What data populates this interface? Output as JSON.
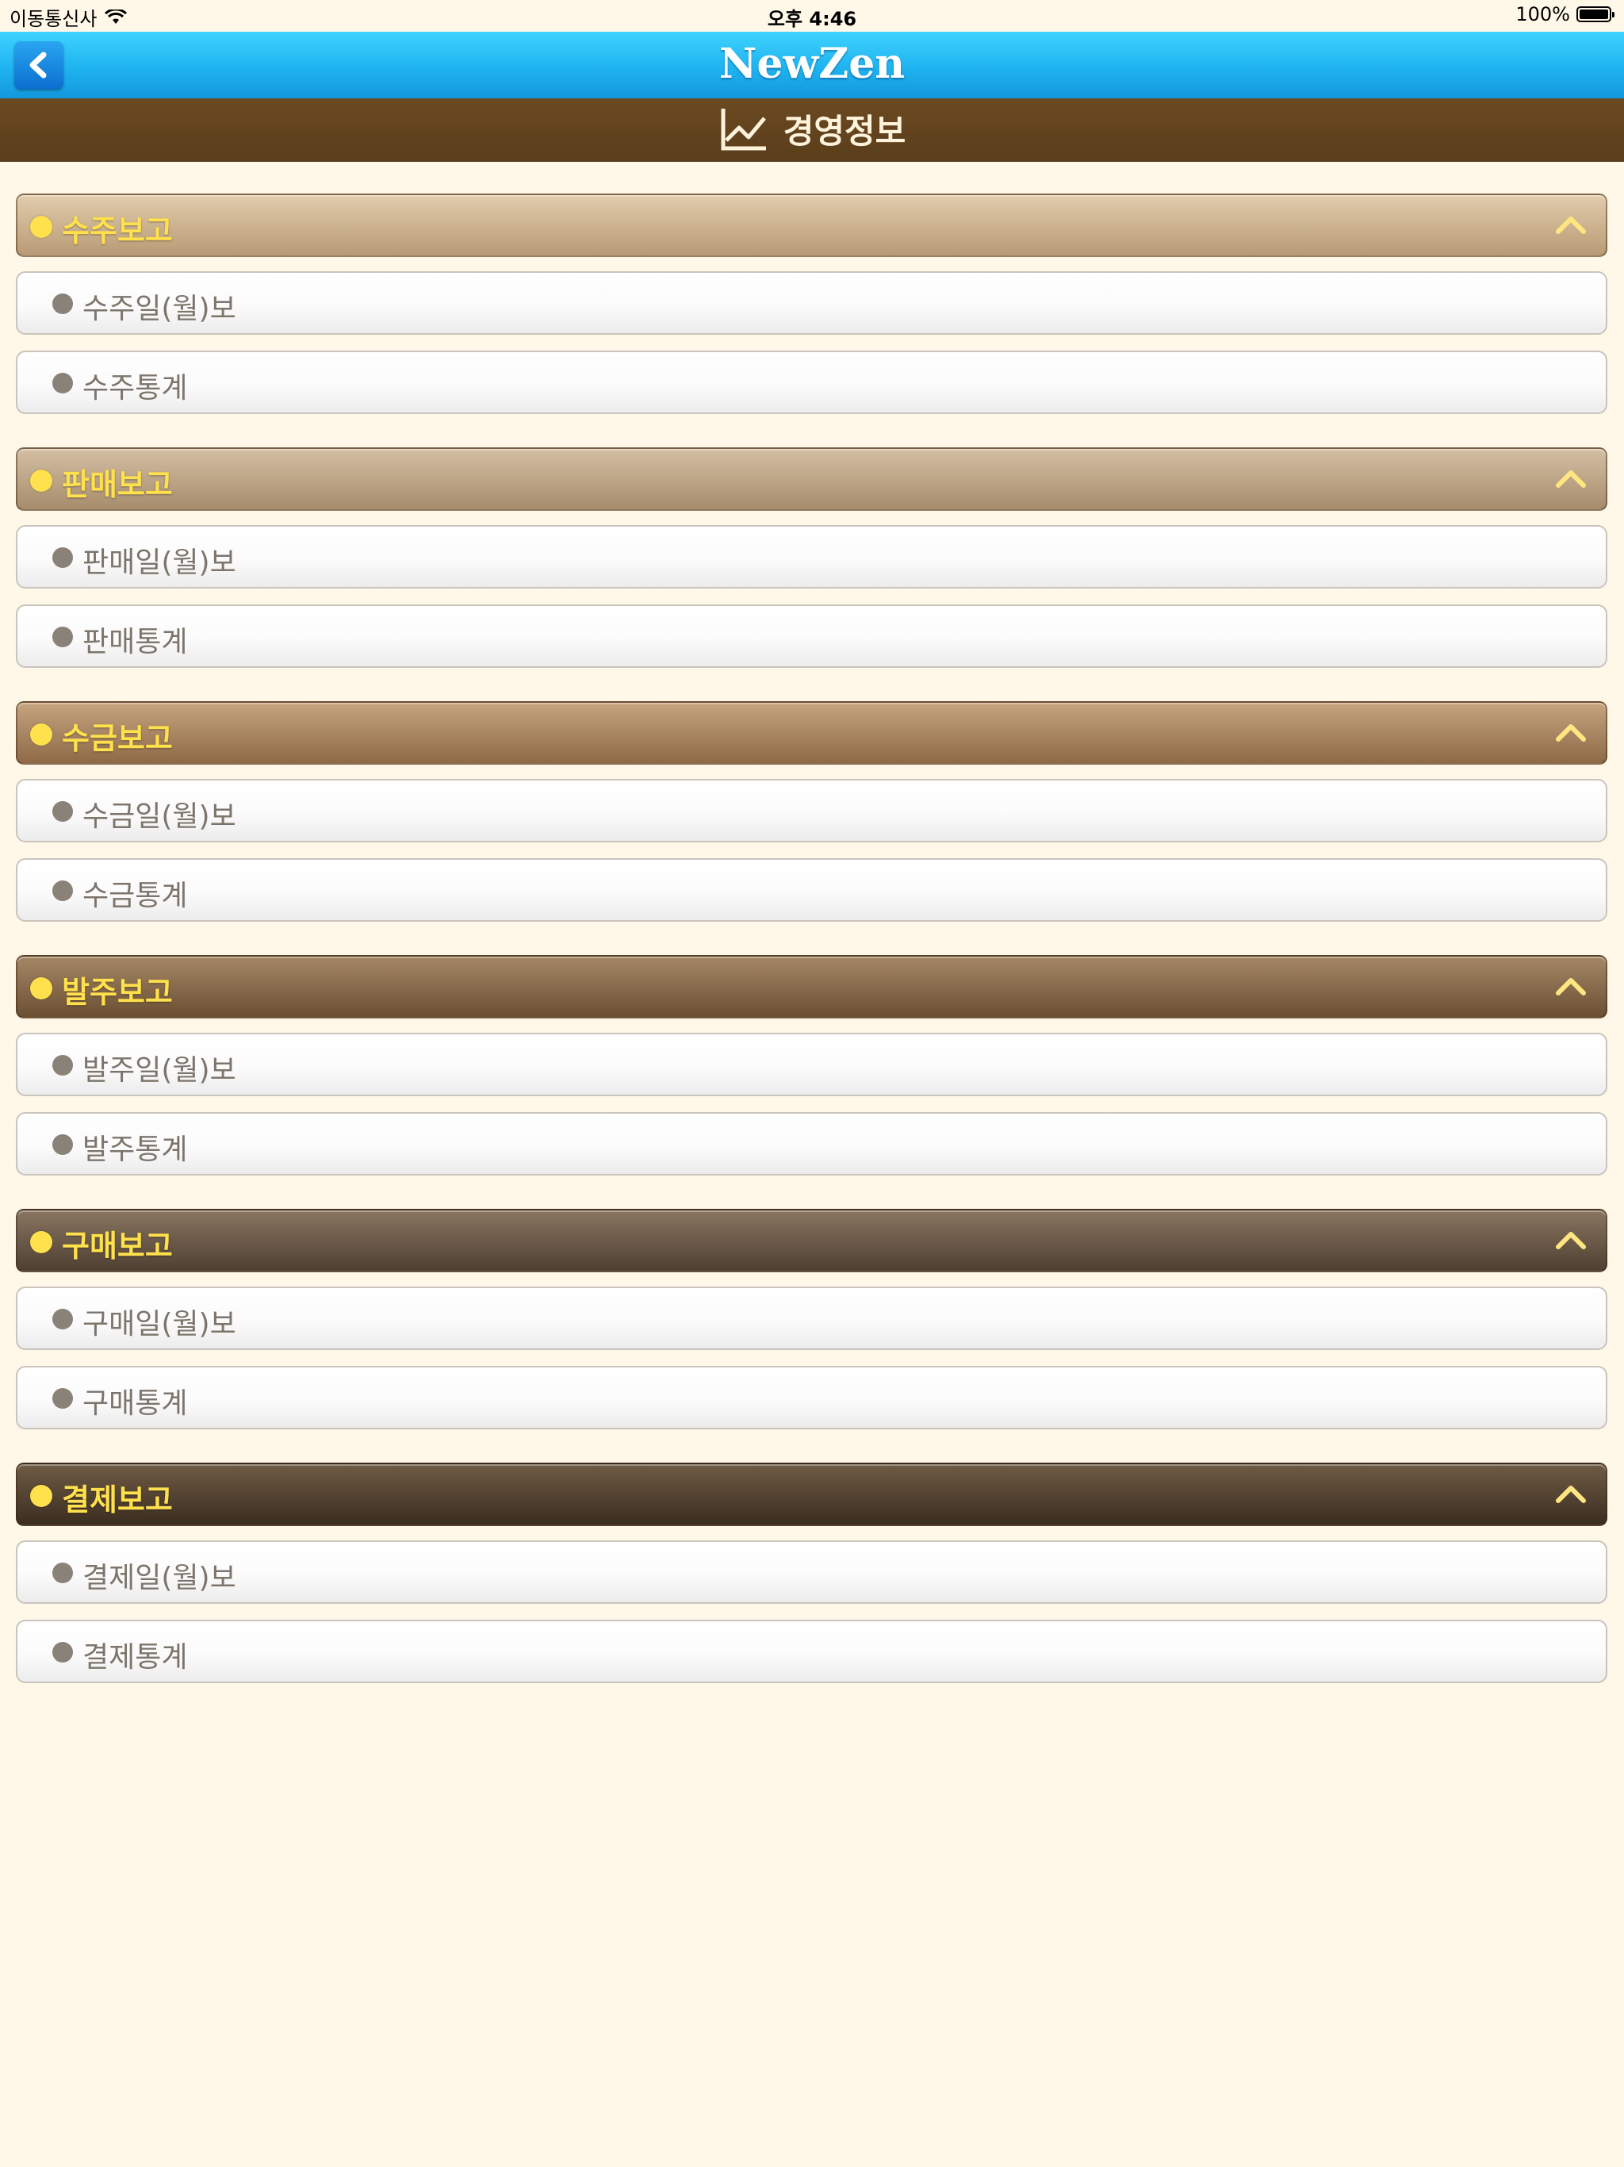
{
  "status_bar": {
    "carrier": "이동통신사",
    "time": "오후 4:46",
    "battery": "100%"
  },
  "nav": {
    "title": "NewZen"
  },
  "section": {
    "title": "경영정보"
  },
  "groups": [
    {
      "title": "수주보고",
      "items": [
        "수주일(월)보",
        "수주통계"
      ]
    },
    {
      "title": "판매보고",
      "items": [
        "판매일(월)보",
        "판매통계"
      ]
    },
    {
      "title": "수금보고",
      "items": [
        "수금일(월)보",
        "수금통계"
      ]
    },
    {
      "title": "발주보고",
      "items": [
        "발주일(월)보",
        "발주통계"
      ]
    },
    {
      "title": "구매보고",
      "items": [
        "구매일(월)보",
        "구매통계"
      ]
    },
    {
      "title": "결제보고",
      "items": [
        "결제일(월)보",
        "결제통계"
      ]
    }
  ],
  "colors": {
    "nav_blue": "#1fb3f0",
    "section_brown": "#5a3d1b",
    "header_label": "#ffe04d",
    "background": "#fff7e8"
  },
  "icons": {
    "back": "chevron-left-icon",
    "section": "line-chart-icon",
    "collapse": "chevron-up-icon",
    "wifi": "wifi-icon",
    "battery": "battery-icon"
  }
}
